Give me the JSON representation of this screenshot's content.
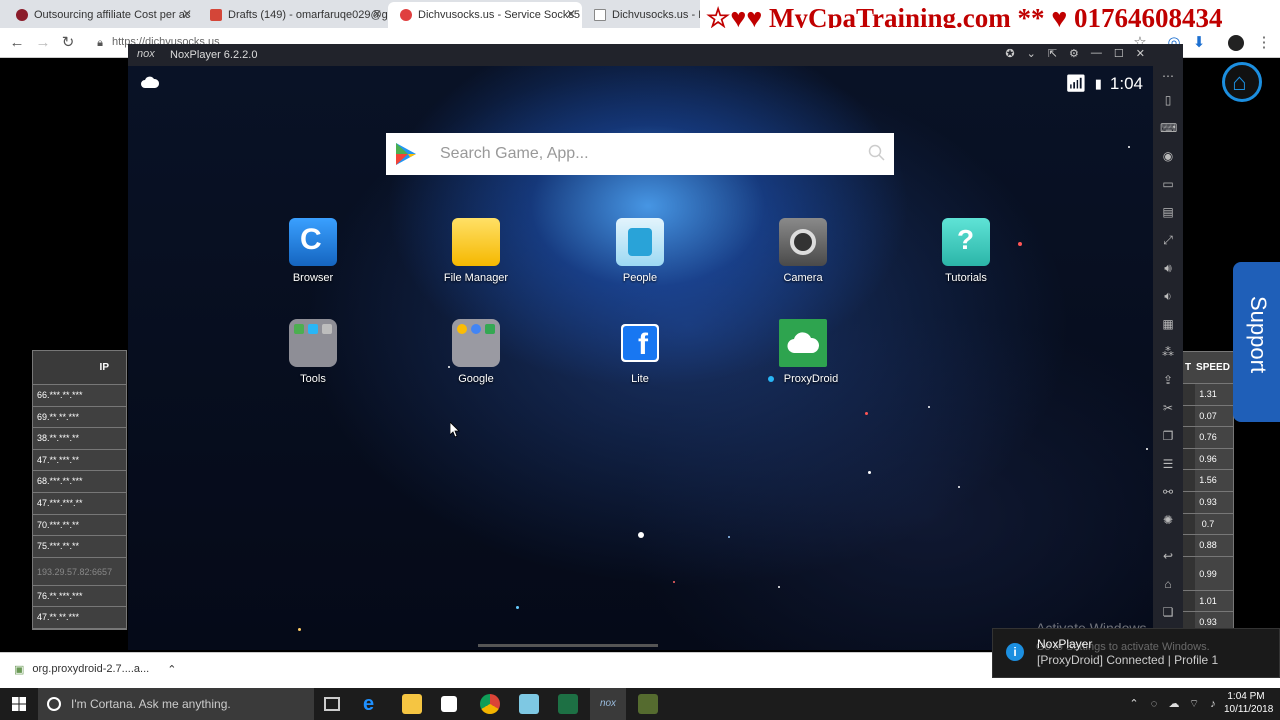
{
  "browser": {
    "tabs": [
      {
        "label": "Outsourcing affiliate Cost per ac",
        "fav_color": "#8b1c2a"
      },
      {
        "label": "Drafts (149) - omarfaruqe029@g",
        "fav_color": "#d44638"
      },
      {
        "label": "Dichvusocks.us - Service Socks5",
        "fav_color": "#e04040"
      },
      {
        "label": "Dichvusocks.us - Pro",
        "fav_color": "#888888"
      }
    ],
    "promo_text": "☆♥♥ MyCpaTraining.com ** ♥ 01764608434",
    "url": "https://dichvusocks.us"
  },
  "nox": {
    "title": "NoxPlayer 6.2.2.0",
    "logo": "nox",
    "time": "1:04",
    "search_placeholder": "Search Game, App...",
    "apps": [
      {
        "label": "Browser",
        "color": "#1e88e5"
      },
      {
        "label": "File Manager",
        "color": "#f7c325"
      },
      {
        "label": "People",
        "color": "#4fc3f7"
      },
      {
        "label": "Camera",
        "color": "#777"
      },
      {
        "label": "Tutorials",
        "color": "#3ad3c5"
      },
      {
        "label": "Tools",
        "color": "#888"
      },
      {
        "label": "Google",
        "color": "#999"
      },
      {
        "label": "Lite",
        "color": "#1877f2"
      },
      {
        "label": "ProxyDroid",
        "color": "#2ea44f"
      }
    ]
  },
  "left_table": {
    "header": "IP",
    "rows": [
      "66.***.**.***",
      "69.**.**.***",
      "38.**.***.**",
      "47.**.***.**",
      "68.***.**.***",
      "47.***.***.**",
      "70.***.**.**",
      "75.***.**.**",
      "193.29.57.82:6657",
      "76.**.***.***",
      "47.**.**.***"
    ]
  },
  "right_table": {
    "col1_header": "T",
    "col2_header": "SPEED",
    "rows": [
      "1.31",
      "0.07",
      "0.76",
      "0.96",
      "1.56",
      "0.93",
      "0.7",
      "0.88",
      "0.99",
      "1.01",
      "0.93"
    ]
  },
  "support_label": "Support",
  "download": {
    "filename": "org.proxydroid-2.7....a..."
  },
  "toast": {
    "title": "NoxPlayer",
    "message": "[ProxyDroid] Connected | Profile 1"
  },
  "watermark": {
    "title": "Activate Windows",
    "subtitle": "Go to Settings to activate Windows."
  },
  "taskbar": {
    "cortana_text": "I'm Cortana. Ask me anything.",
    "time": "1:04 PM",
    "date": "10/11/2018"
  }
}
